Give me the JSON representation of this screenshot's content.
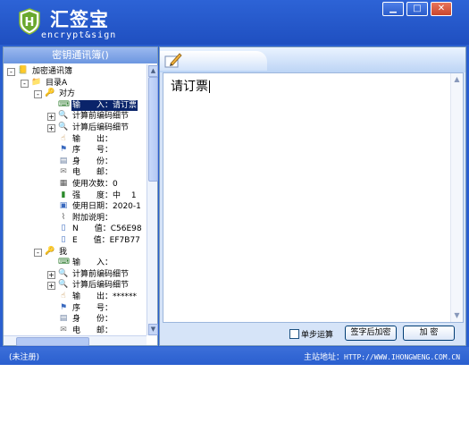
{
  "titlebar": {
    "app_name": "汇签宝",
    "app_subtitle": "encrypt&sign",
    "logo_letter": "H",
    "minimize": "▁",
    "maximize": "□",
    "close": "✕"
  },
  "left_panel": {
    "header": "密钥通讯簿()",
    "tree": [
      {
        "label": "加密通讯簿",
        "icon": "book-icon"
      },
      {
        "label": "目录A",
        "icon": "folder-icon"
      },
      {
        "label": "对方",
        "icon": "key-icon"
      },
      {
        "label": "输　　入：请订票",
        "icon": "input-icon",
        "selected": true
      },
      {
        "label": "计算前编码细节",
        "icon": "magnifier-icon"
      },
      {
        "label": "计算后编码细节",
        "icon": "magnifier-icon"
      },
      {
        "label": "输　　出：",
        "icon": "hand-icon"
      },
      {
        "label": "序　　号：",
        "icon": "flag-icon"
      },
      {
        "label": "身　　份：",
        "icon": "id-card-icon"
      },
      {
        "label": "电　　邮：",
        "icon": "mail-icon"
      },
      {
        "label": "使用次数：0",
        "icon": "counter-icon"
      },
      {
        "label": "强　　度：中　 1",
        "icon": "strength-icon"
      },
      {
        "label": "使用日期：2020-1",
        "icon": "calendar-icon"
      },
      {
        "label": "附加说明：",
        "icon": "paperclip-icon"
      },
      {
        "label": "N　　值：C56E98",
        "icon": "doc-icon"
      },
      {
        "label": "E　　值：EF7B77",
        "icon": "doc-icon"
      },
      {
        "label": "我",
        "icon": "key-icon"
      },
      {
        "label": "输　　入：",
        "icon": "input-icon"
      },
      {
        "label": "计算前编码细节",
        "icon": "magnifier-icon"
      },
      {
        "label": "计算后编码细节",
        "icon": "magnifier-icon"
      },
      {
        "label": "输　　出：******",
        "icon": "hand-icon"
      },
      {
        "label": "序　　号：",
        "icon": "flag-icon"
      },
      {
        "label": "身　　份：",
        "icon": "id-card-icon"
      },
      {
        "label": "电　　邮：",
        "icon": "mail-icon"
      }
    ]
  },
  "editor": {
    "content": "请订票"
  },
  "controls": {
    "step_label": "单步运算",
    "sign_encrypt_label": "签字后加密",
    "encrypt_label": "加 密"
  },
  "status": {
    "left": "(未注册)",
    "site_label": "主站地址：",
    "site_url": "HTTP://WWW.IHONGWENG.COM.CN"
  },
  "colors": {
    "chrome": "#2a5fcf",
    "selection": "#0a246a",
    "panel_header": "#6c96e0"
  }
}
